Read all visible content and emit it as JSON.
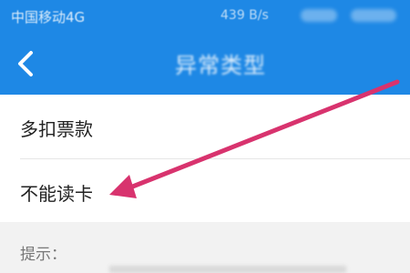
{
  "status_bar": {
    "carrier": "中国移动4G",
    "speed": "439 B/s"
  },
  "nav": {
    "title": "异常类型",
    "back_icon": "chevron-left-icon"
  },
  "options": [
    {
      "label": "多扣票款"
    },
    {
      "label": "不能读卡"
    }
  ],
  "tip": {
    "label": "提示："
  },
  "colors": {
    "primary": "#1e88e5",
    "arrow": "#d8336e",
    "text": "#222222",
    "muted": "#777777"
  }
}
